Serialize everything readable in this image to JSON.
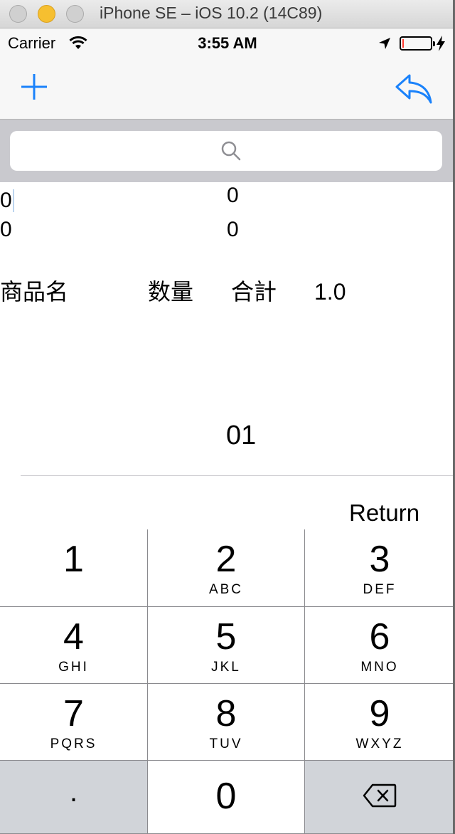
{
  "window": {
    "title": "iPhone SE – iOS 10.2 (14C89)"
  },
  "status_bar": {
    "carrier": "Carrier",
    "time": "3:55 AM",
    "battery_level": 0.05,
    "icons": [
      "wifi-icon",
      "location-arrow-icon",
      "battery-icon",
      "charging-bolt-icon"
    ]
  },
  "nav_bar": {
    "left_icon": "plus-icon",
    "right_icon": "reply-arrow-icon",
    "tint_color": "#1a82fb"
  },
  "search": {
    "placeholder": "",
    "icon": "search-icon"
  },
  "content": {
    "row1_left": "0",
    "row1_right": "0",
    "row2_left": "0",
    "row2_right": "0",
    "header_product": "商品名",
    "header_quantity": "数量",
    "header_total": "合計",
    "header_value": "1.0",
    "input_value": "01"
  },
  "keyboard_toolbar": {
    "return_label": "Return"
  },
  "keypad": {
    "keys": [
      {
        "number": "1",
        "letters": ""
      },
      {
        "number": "2",
        "letters": "ABC"
      },
      {
        "number": "3",
        "letters": "DEF"
      },
      {
        "number": "4",
        "letters": "GHI"
      },
      {
        "number": "5",
        "letters": "JKL"
      },
      {
        "number": "6",
        "letters": "MNO"
      },
      {
        "number": "7",
        "letters": "PQRS"
      },
      {
        "number": "8",
        "letters": "TUV"
      },
      {
        "number": "9",
        "letters": "WXYZ"
      }
    ],
    "dot": ".",
    "zero": "0",
    "delete_icon": "backspace-icon"
  }
}
